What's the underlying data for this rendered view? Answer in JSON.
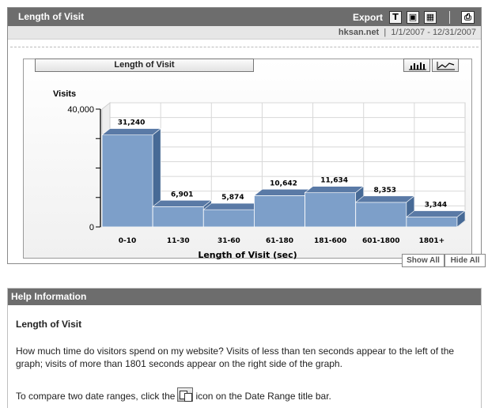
{
  "header": {
    "title": "Length of Visit",
    "export_label": "Export",
    "export_icons": [
      {
        "name": "text-export-icon",
        "glyph": "T"
      },
      {
        "name": "pdf-export-icon",
        "glyph": "▣"
      },
      {
        "name": "excel-export-icon",
        "glyph": "▦"
      }
    ],
    "print_glyph": "⎙"
  },
  "info_bar": {
    "site": "hksan.net",
    "separator": "|",
    "date_range": "1/1/2007 - 12/31/2007"
  },
  "chart_panel": {
    "tab_title": "Length of Visit",
    "show_all_label": "Show All",
    "hide_all_label": "Hide All"
  },
  "chart_data": {
    "type": "bar",
    "title": "",
    "ylabel": "Visits",
    "xlabel": "Length of Visit (sec)",
    "ylim": [
      0,
      40000
    ],
    "ytick_labels": [
      "40,000",
      "0"
    ],
    "categories": [
      "0-10",
      "11-30",
      "31-60",
      "61-180",
      "181-600",
      "601-1800",
      "1801+"
    ],
    "values": [
      31240,
      6901,
      5874,
      10642,
      11634,
      8353,
      3344
    ],
    "value_labels": [
      "31,240",
      "6,901",
      "5,874",
      "10,642",
      "11,634",
      "8,353",
      "3,344"
    ],
    "grid": true,
    "colors": {
      "bar_front": "#7d9fc9",
      "bar_top": "#5a7aa6",
      "bar_side": "#476a96",
      "bar_edge": "#ffffff"
    }
  },
  "help": {
    "header": "Help Information",
    "subtitle": "Length of Visit",
    "paragraph1": "How much time do visitors spend on my website? Visits of less than ten seconds appear to the left of the graph; visits of more than 1801 seconds appear on the right side of the graph.",
    "paragraph2_before": "To compare two date ranges, click the",
    "paragraph2_after": "icon on the Date Range title bar."
  }
}
